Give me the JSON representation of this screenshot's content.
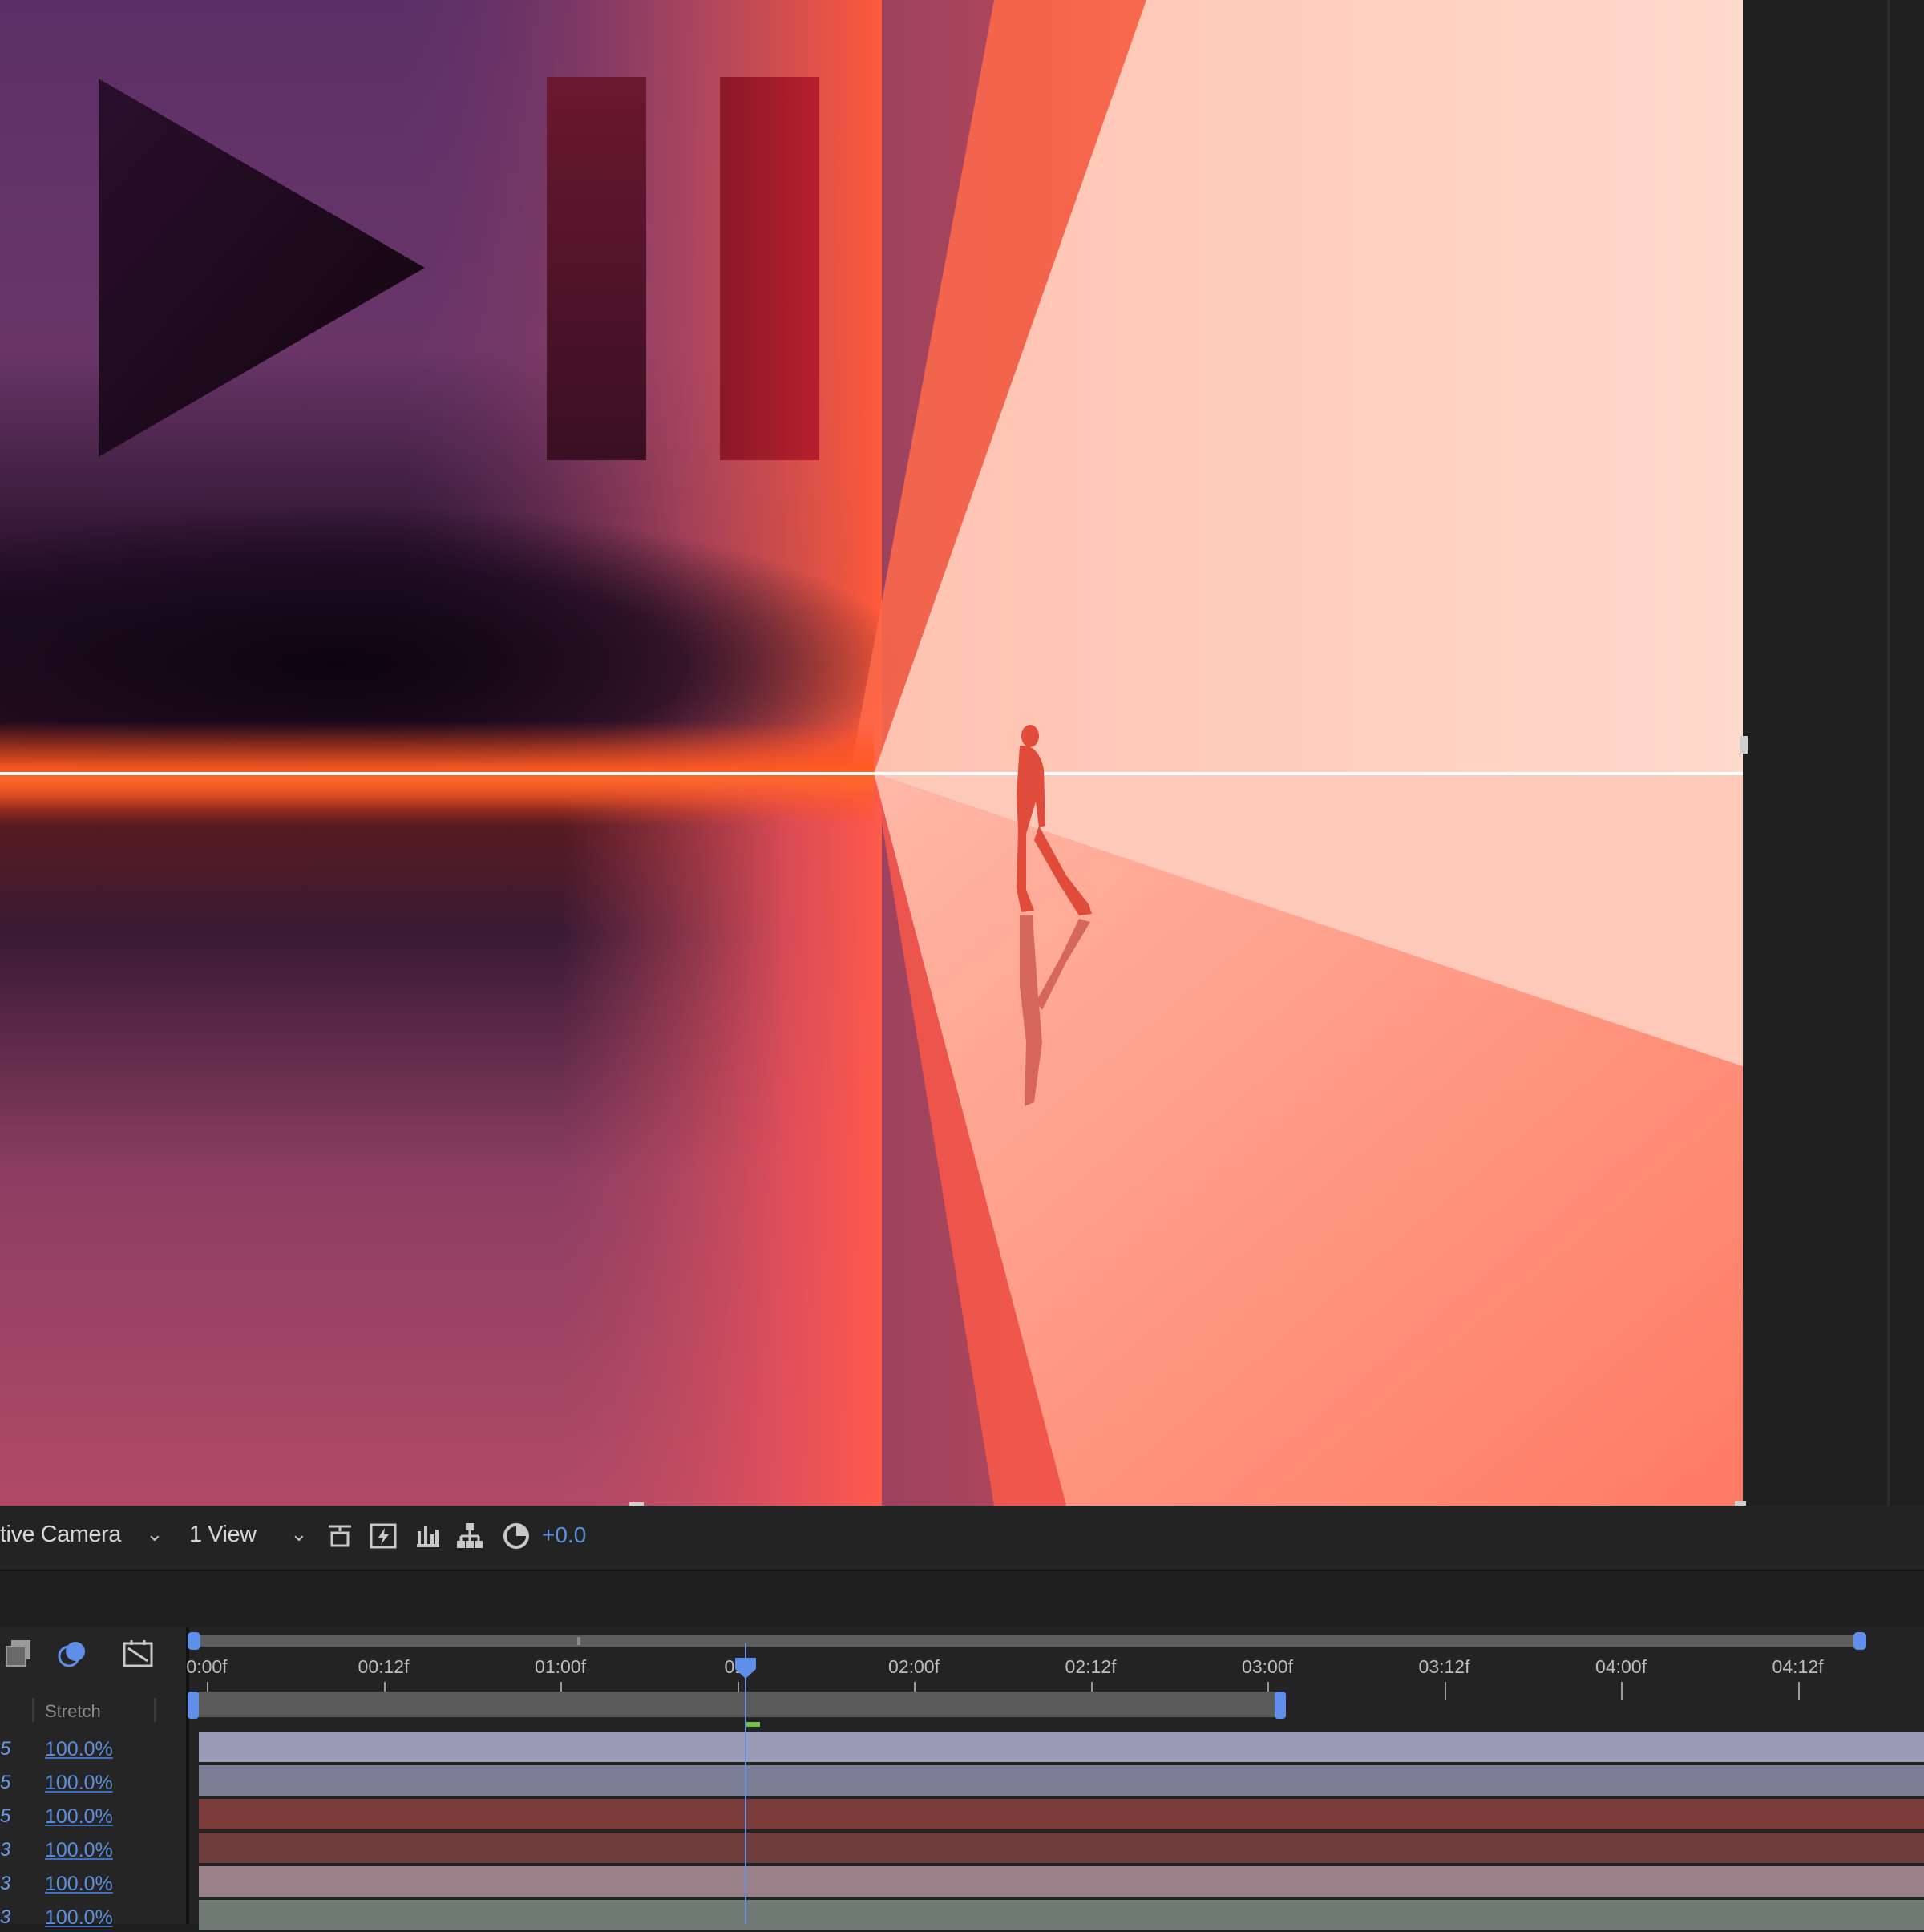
{
  "viewer": {
    "overlay_icons": [
      "play-icon",
      "pause-icon"
    ],
    "colors": {
      "shadow": "#1a0a1e",
      "horizon_glow": "#ff4a1a",
      "light_beam": "#ffd6c8",
      "floor_right": "#ff7a62",
      "play_icon": "#200c22",
      "pause_bar": "#a81a2c"
    }
  },
  "toolbar": {
    "camera_select": "tive Camera",
    "view_select": "1 View",
    "icons": [
      "grid-guides-icon",
      "fast-preview-icon",
      "channel-icon",
      "flowchart-icon",
      "exposure-reset-icon"
    ],
    "exposure_value": "+0.0"
  },
  "timeline": {
    "header_icons": [
      "comp-layers-icon",
      "motion-blur-icon",
      "draft-3d-icon"
    ],
    "column_header": "Stretch",
    "ruler_labels": [
      "0:00f",
      "00:12f",
      "01:00f",
      "01:",
      "02:00f",
      "02:12f",
      "03:00f",
      "03:12f",
      "04:00f",
      "04:12f"
    ],
    "rows": [
      {
        "index": "5",
        "stretch": "100.0%",
        "color": "#9b9bb8"
      },
      {
        "index": "5",
        "stretch": "100.0%",
        "color": "#7a7f96"
      },
      {
        "index": "5",
        "stretch": "100.0%",
        "color": "#7a3c3a"
      },
      {
        "index": "3",
        "stretch": "100.0%",
        "color": "#6f3d3d"
      },
      {
        "index": "3",
        "stretch": "100.0%",
        "color": "#9a8088"
      },
      {
        "index": "3",
        "stretch": "100.0%",
        "color": "#6f7a74"
      }
    ],
    "accent_color": "#5f8fe8",
    "cache_color": "#6fbf4a"
  }
}
